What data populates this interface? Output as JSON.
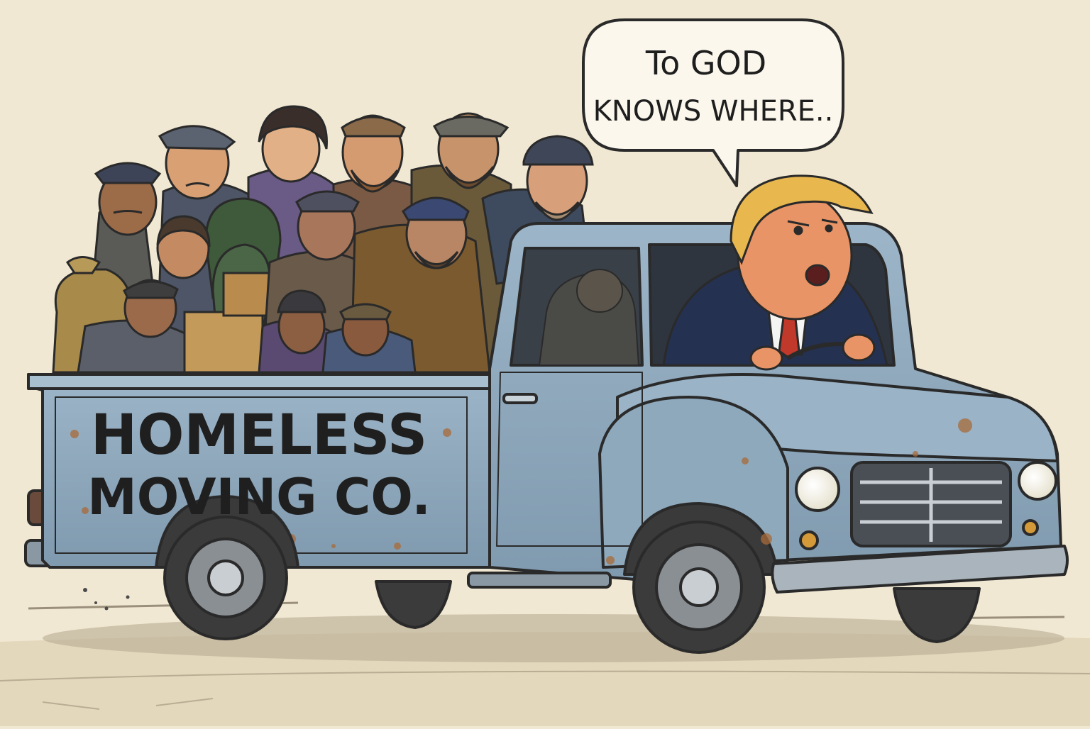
{
  "cartoon": {
    "speech": {
      "line1": "To GOD",
      "line2": "KNOWS WHERE.."
    },
    "truck_sign": {
      "line1": "HOMELESS",
      "line2": "MOVING CO."
    }
  },
  "colors": {
    "paper": "#f1e8d3",
    "truck_blue": "#8fa9bd",
    "outline": "#2a2a2a",
    "rust": "#a86b3a",
    "suit": "#243150",
    "hair": "#e8b84f",
    "skin_driver": "#e89466",
    "tie": "#c0392b"
  }
}
